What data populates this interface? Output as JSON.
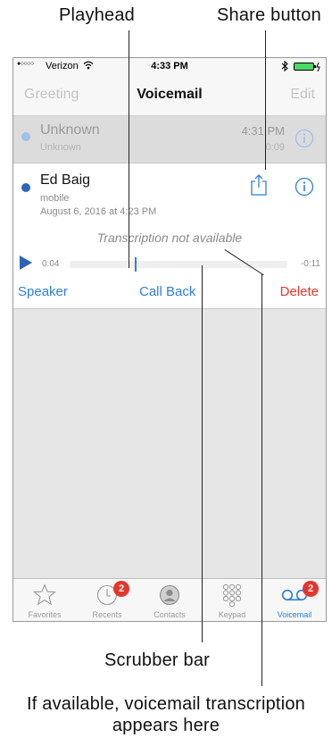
{
  "callouts": {
    "playhead": "Playhead",
    "share_button": "Share button",
    "scrubber_bar": "Scrubber bar",
    "transcription_line1": "If available, voicemail transcription",
    "transcription_line2": "appears here"
  },
  "status_bar": {
    "signal": "●○○○○",
    "carrier": "Verizon",
    "time": "4:33 PM"
  },
  "nav": {
    "left": "Greeting",
    "title": "Voicemail",
    "right": "Edit"
  },
  "voicemails": [
    {
      "name": "Unknown",
      "subtitle": "Unknown",
      "time": "4:31 PM",
      "duration": "0:09"
    },
    {
      "name": "Ed Baig",
      "label": "mobile",
      "date": "August 6, 2016 at 4:23 PM",
      "transcription": "Transcription not available",
      "elapsed": "0:04",
      "remaining": "-0:11",
      "progress": 0.3
    }
  ],
  "actions": {
    "speaker": "Speaker",
    "call_back": "Call Back",
    "delete": "Delete"
  },
  "tabs": [
    {
      "label": "Favorites",
      "icon": "star-icon"
    },
    {
      "label": "Recents",
      "icon": "clock-icon",
      "badge": "2"
    },
    {
      "label": "Contacts",
      "icon": "contacts-icon"
    },
    {
      "label": "Keypad",
      "icon": "keypad-icon"
    },
    {
      "label": "Voicemail",
      "icon": "voicemail-icon",
      "badge": "2"
    }
  ],
  "colors": {
    "accent": "#2f7fd8",
    "delete": "#e3362d",
    "badge": "#e3362d",
    "battery": "#4cd964"
  }
}
